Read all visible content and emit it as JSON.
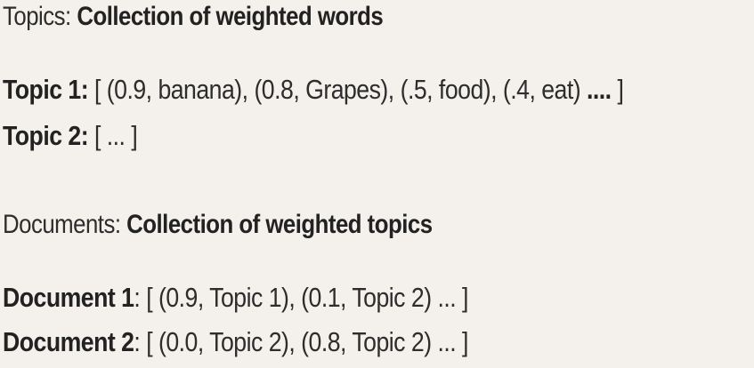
{
  "topics": {
    "heading_label": "Topics:",
    "heading_desc": "Collection of weighted words",
    "items": [
      {
        "label": "Topic 1:",
        "content": "[ (0.9, banana), (0.8, Grapes), (.5, food), (.4, eat) ",
        "trail": "....",
        "close": " ]"
      },
      {
        "label": "Topic 2:",
        "content": "[ ... ]"
      }
    ]
  },
  "documents": {
    "heading_label": "Documents:",
    "heading_desc": "Collection of weighted topics",
    "items": [
      {
        "label": "Document 1",
        "content": ": [ (0.9, Topic 1), (0.1, Topic 2) ... ]"
      },
      {
        "label": "Document 2",
        "content": ": [ (0.0, Topic 2), (0.8, Topic 2) ... ]"
      }
    ]
  }
}
